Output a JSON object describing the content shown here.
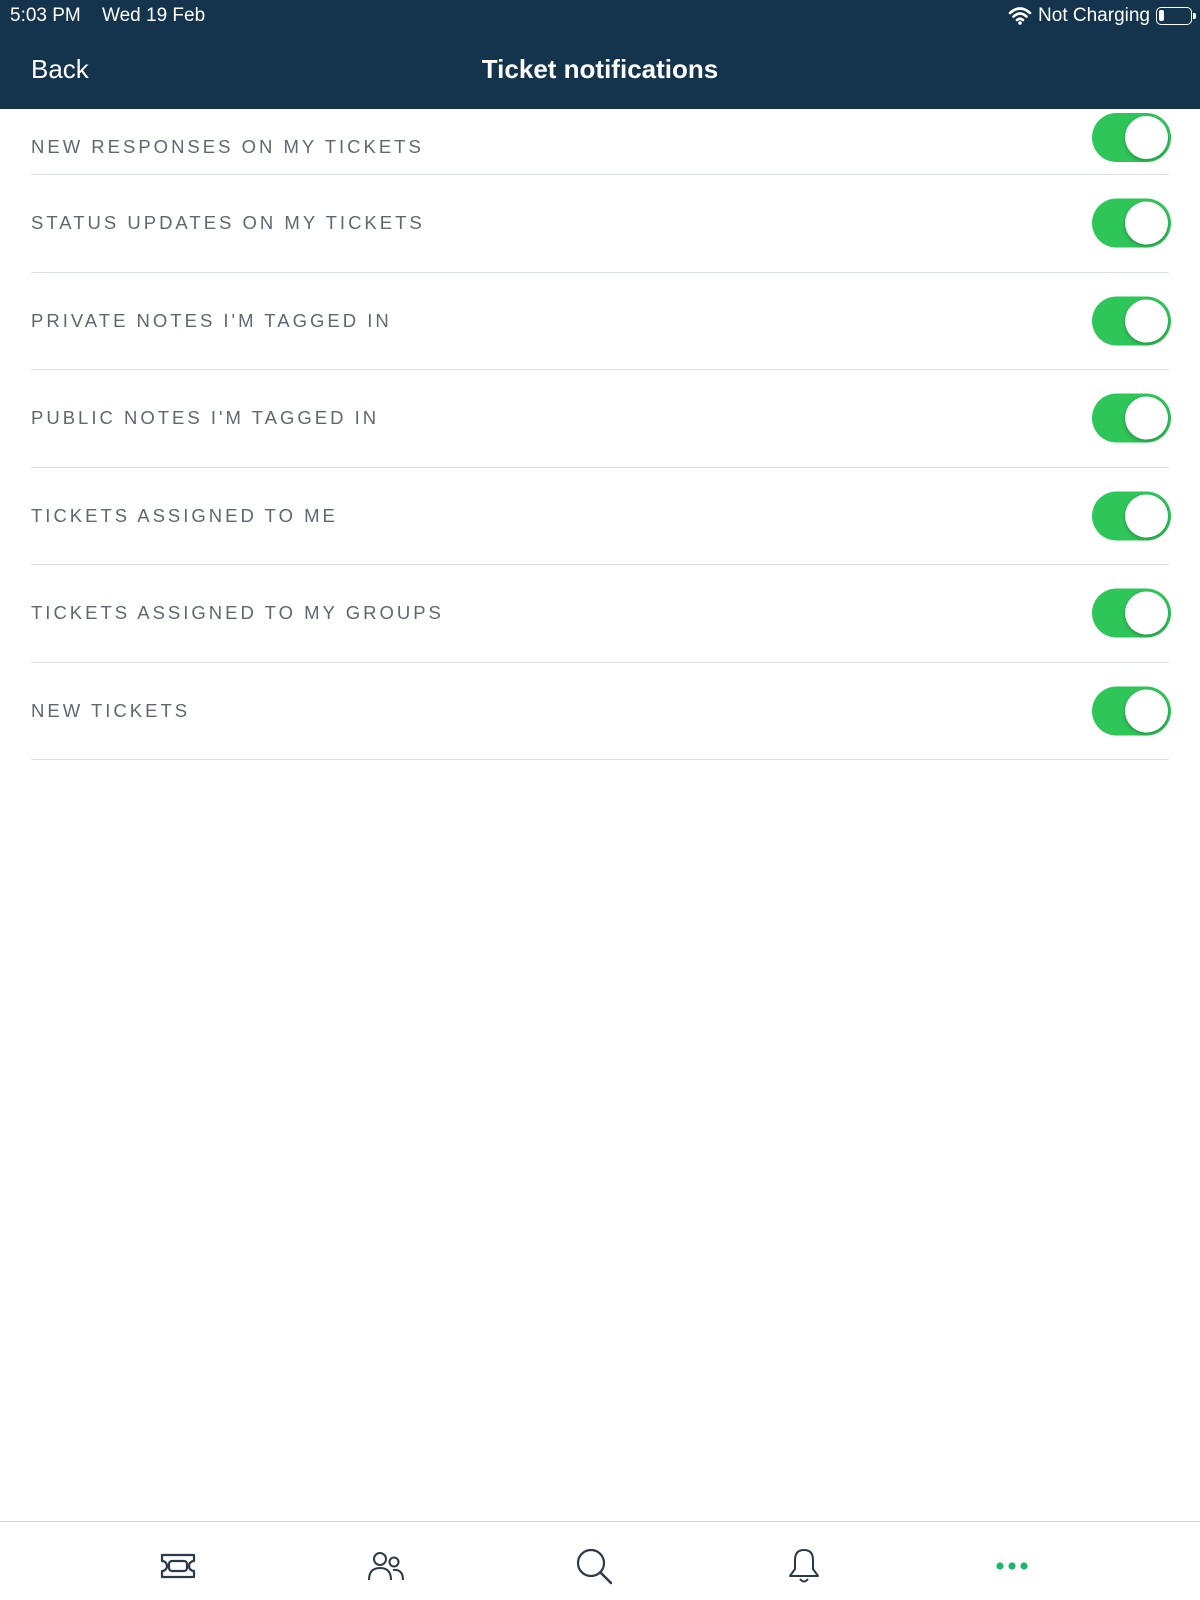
{
  "status_bar": {
    "time": "5:03 PM",
    "date": "Wed 19 Feb",
    "battery_text": "Not Charging"
  },
  "nav": {
    "back_label": "Back",
    "title": "Ticket notifications"
  },
  "settings": [
    {
      "label": "NEW RESPONSES ON MY TICKETS",
      "enabled": true
    },
    {
      "label": "STATUS UPDATES ON MY TICKETS",
      "enabled": true
    },
    {
      "label": "PRIVATE NOTES I'M TAGGED IN",
      "enabled": true
    },
    {
      "label": "PUBLIC NOTES I'M TAGGED IN",
      "enabled": true
    },
    {
      "label": "TICKETS ASSIGNED TO ME",
      "enabled": true
    },
    {
      "label": "TICKETS ASSIGNED TO MY GROUPS",
      "enabled": true
    },
    {
      "label": "NEW TICKETS",
      "enabled": true
    }
  ],
  "tabs": [
    {
      "icon": "ticket-icon",
      "active": false
    },
    {
      "icon": "contacts-icon",
      "active": false
    },
    {
      "icon": "search-icon",
      "active": false
    },
    {
      "icon": "bell-icon",
      "active": false
    },
    {
      "icon": "more-icon",
      "active": true
    }
  ],
  "colors": {
    "header_bg": "#14344d",
    "toggle_on": "#2fc659",
    "active_tab": "#1fb56a",
    "icon": "#2b3a4a"
  }
}
